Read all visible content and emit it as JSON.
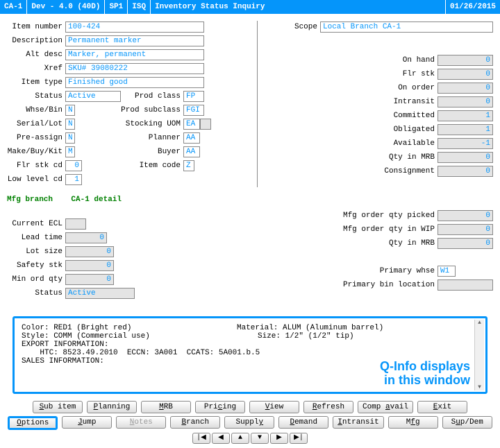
{
  "titlebar": {
    "branch": "CA-1",
    "env": "Dev - 4.0 (40D)",
    "sp": "SP1",
    "code": "ISQ",
    "title": "Inventory Status Inquiry",
    "date": "01/26/2015"
  },
  "left": {
    "item_number_lbl": "Item number",
    "item_number": "100-424",
    "description_lbl": "Description",
    "description": "Permanent marker",
    "alt_desc_lbl": "Alt desc",
    "alt_desc": "Marker, permanent",
    "xref_lbl": "Xref",
    "xref": "SKU# 39080222",
    "item_type_lbl": "Item type",
    "item_type": "Finished good",
    "status_lbl": "Status",
    "status": "Active",
    "whse_bin_lbl": "Whse/Bin",
    "whse_bin": "N",
    "serial_lot_lbl": "Serial/Lot",
    "serial_lot": "N",
    "pre_assign_lbl": "Pre-assign",
    "pre_assign": "N",
    "make_buy_kit_lbl": "Make/Buy/Kit",
    "make_buy_kit": "M",
    "flr_stk_cd_lbl": "Flr stk cd",
    "flr_stk_cd": "0",
    "low_level_cd_lbl": "Low level cd",
    "low_level_cd": "1"
  },
  "mid": {
    "prod_class_lbl": "Prod class",
    "prod_class": "FP",
    "prod_subclass_lbl": "Prod subclass",
    "prod_subclass": "FGI",
    "stocking_uom_lbl": "Stocking UOM",
    "stocking_uom": "EA",
    "planner_lbl": "Planner",
    "planner": "AA",
    "buyer_lbl": "Buyer",
    "buyer": "AA",
    "item_code_lbl": "Item code",
    "item_code": "Z"
  },
  "scope": {
    "scope_lbl": "Scope",
    "scope": "Local Branch CA-1"
  },
  "right": {
    "on_hand_lbl": "On hand",
    "on_hand": "0",
    "flr_stk_lbl": "Flr stk",
    "flr_stk": "0",
    "on_order_lbl": "On order",
    "on_order": "0",
    "intransit_lbl": "Intransit",
    "intransit": "0",
    "committed_lbl": "Committed",
    "committed": "1",
    "obligated_lbl": "Obligated",
    "obligated": "1",
    "available_lbl": "Available",
    "available": "-1",
    "qty_in_mrb_lbl": "Qty in MRB",
    "qty_in_mrb": "0",
    "consignment_lbl": "Consignment",
    "consignment": "0"
  },
  "detail_hdr": {
    "mfg_branch_lbl": "Mfg branch",
    "detail_lbl": "CA-1 detail"
  },
  "detail_left": {
    "current_ecl_lbl": "Current ECL",
    "current_ecl": "",
    "lead_time_lbl": "Lead time",
    "lead_time": "0",
    "lot_size_lbl": "Lot size",
    "lot_size": "0",
    "safety_stk_lbl": "Safety stk",
    "safety_stk": "0",
    "min_ord_qty_lbl": "Min ord qty",
    "min_ord_qty": "0",
    "status_lbl": "Status",
    "status": "Active"
  },
  "detail_right": {
    "mfg_order_qty_picked_lbl": "Mfg order qty picked",
    "mfg_order_qty_picked": "0",
    "mfg_order_qty_wip_lbl": "Mfg order qty in WIP",
    "mfg_order_qty_wip": "0",
    "qty_in_mrb_lbl": "Qty in MRB",
    "qty_in_mrb": "0",
    "primary_whse_lbl": "Primary whse",
    "primary_whse": "W1",
    "primary_bin_lbl": "Primary bin location",
    "primary_bin": ""
  },
  "qinfo": {
    "line1a": "Color: RED1 (Bright red)",
    "line1b": "Material: ALUM (Aluminum barrel)",
    "line2a": "Style: COMM (Commercial use)",
    "line2b": "Size: 1/2\" (1/2\" tip)",
    "line3": "EXPORT INFORMATION:",
    "line4": "    HTC: 8523.49.2010  ECCN: 3A001  CCATS: 5A001.b.5",
    "line5": "",
    "line6": "SALES INFORMATION:",
    "overlay1": "Q-Info displays",
    "overlay2": "in this window"
  },
  "buttons": {
    "row1": [
      "Sub item",
      "Planning",
      "MRB",
      "Pricing",
      "View",
      "Refresh",
      "Comp avail",
      "Exit"
    ],
    "row2": [
      "Options",
      "Jump",
      "Notes",
      "Branch",
      "Supply",
      "Demand",
      "Intransit",
      "Mfg",
      "Sup/Dem"
    ]
  }
}
